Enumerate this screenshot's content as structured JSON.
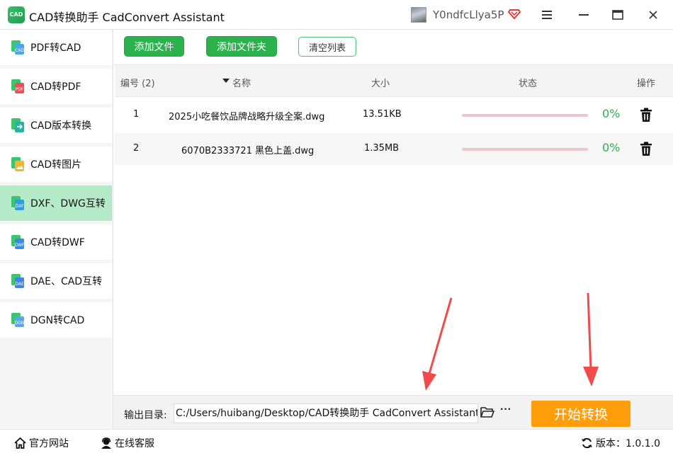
{
  "app": {
    "logo_text": "CAD",
    "title": "CAD转换助手 CadConvert Assistant",
    "user_name": "Y0ndfcLlya5P"
  },
  "sidebar": {
    "items": [
      {
        "label": "PDF转CAD",
        "icon": "pdf-to-cad-icon",
        "active": false
      },
      {
        "label": "CAD转PDF",
        "icon": "cad-to-pdf-icon",
        "active": false
      },
      {
        "label": "CAD版本转换",
        "icon": "cad-version-icon",
        "active": false
      },
      {
        "label": "CAD转图片",
        "icon": "cad-to-image-icon",
        "active": false
      },
      {
        "label": "DXF、DWG互转",
        "icon": "dxf-dwg-icon",
        "active": true
      },
      {
        "label": "CAD转DWF",
        "icon": "cad-to-dwf-icon",
        "active": false
      },
      {
        "label": "DAE、CAD互转",
        "icon": "dae-cad-icon",
        "active": false
      },
      {
        "label": "DGN转CAD",
        "icon": "dgn-to-cad-icon",
        "active": false
      }
    ]
  },
  "toolbar": {
    "add_file": "添加文件",
    "add_folder": "添加文件夹",
    "clear_list": "清空列表"
  },
  "table": {
    "headers": {
      "index": "编号 (2)",
      "name": "名称",
      "size": "大小",
      "status": "状态",
      "action": "操作"
    },
    "rows": [
      {
        "index": "1",
        "name": "2025小吃餐饮品牌战略升级全案.dwg",
        "size": "13.51KB",
        "progress": 0,
        "percent": "0%"
      },
      {
        "index": "2",
        "name": "6070B2333721 黑色上盖.dwg",
        "size": "1.35MB",
        "progress": 0,
        "percent": "0%"
      }
    ]
  },
  "output": {
    "label": "输出目录:",
    "path": "C:/Users/huibang/Desktop/CAD转换助手 CadConvert Assistant",
    "more": "···"
  },
  "start_button": "开始转换",
  "footer": {
    "website": "官方网站",
    "support": "在线客服",
    "version": "版本：1.0.1.0"
  },
  "colors": {
    "accent_green": "#2bb24c",
    "active_bg": "#b5eac9",
    "start_orange": "#ff9d0a",
    "arrow_red": "#f04a4a"
  }
}
